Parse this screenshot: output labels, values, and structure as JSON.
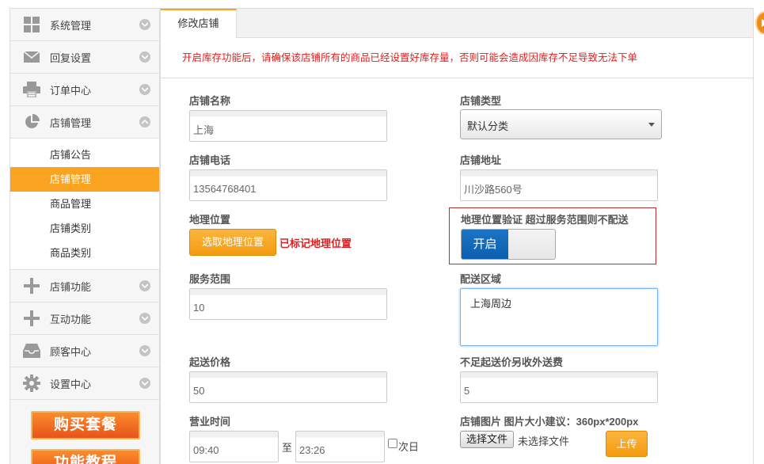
{
  "sidebar": {
    "top_items": [
      {
        "label": "系统管理",
        "icon": "grid-icon"
      },
      {
        "label": "回复设置",
        "icon": "mail-icon"
      },
      {
        "label": "订单中心",
        "icon": "printer-icon"
      },
      {
        "label": "店铺管理",
        "icon": "pie-chart-icon",
        "expanded": true
      }
    ],
    "sub_items": [
      {
        "label": "店铺公告"
      },
      {
        "label": "店铺管理",
        "active": true
      },
      {
        "label": "商品管理"
      },
      {
        "label": "店铺类别"
      },
      {
        "label": "商品类别"
      }
    ],
    "bottom_items": [
      {
        "label": "店铺功能",
        "icon": "plus-icon"
      },
      {
        "label": "互动功能",
        "icon": "plus-icon"
      },
      {
        "label": "顾客中心",
        "icon": "inbox-icon"
      },
      {
        "label": "设置中心",
        "icon": "gear-icon"
      }
    ],
    "buy_button": "购买套餐",
    "tutorial_button": "功能教程"
  },
  "main": {
    "tab_label": "修改店铺",
    "notice": "开启库存功能后，请确保该店铺所有的商品已经设置好库存量，否则可能会造成因库存不足导致无法下单"
  },
  "form": {
    "shop_name": {
      "label": "店铺名称",
      "value": "上海"
    },
    "shop_type": {
      "label": "店铺类型",
      "value": "默认分类"
    },
    "shop_phone": {
      "label": "店铺电话",
      "value": "13564768401"
    },
    "shop_address": {
      "label": "店铺地址",
      "value": "川沙路560号"
    },
    "geo_location": {
      "label": "地理位置",
      "button": "选取地理位置",
      "status": "已标记地理位置"
    },
    "geo_verify": {
      "label": "地理位置验证 超过服务范围则不配送",
      "toggle_on": "开启",
      "enabled": true
    },
    "service_range": {
      "label": "服务范围",
      "value": "10"
    },
    "delivery_area": {
      "label": "配送区域",
      "value": "上海周边"
    },
    "min_price": {
      "label": "起送价格",
      "value": "50"
    },
    "extra_fee": {
      "label": "不足起送价另收外送费",
      "value": "5"
    },
    "business_hours": {
      "label": "营业时间",
      "start": "09:40",
      "separator": "至",
      "end": "23:26",
      "next_day": "次日"
    },
    "shop_image": {
      "label": "店铺图片 图片大小建议：360px*200px",
      "choose_button": "选择文件",
      "no_file": "未选择文件",
      "upload_button": "上传"
    }
  },
  "colors": {
    "accent": "#f9a320",
    "notice_red": "#e02020",
    "toggle_blue": "#0b5fae"
  }
}
